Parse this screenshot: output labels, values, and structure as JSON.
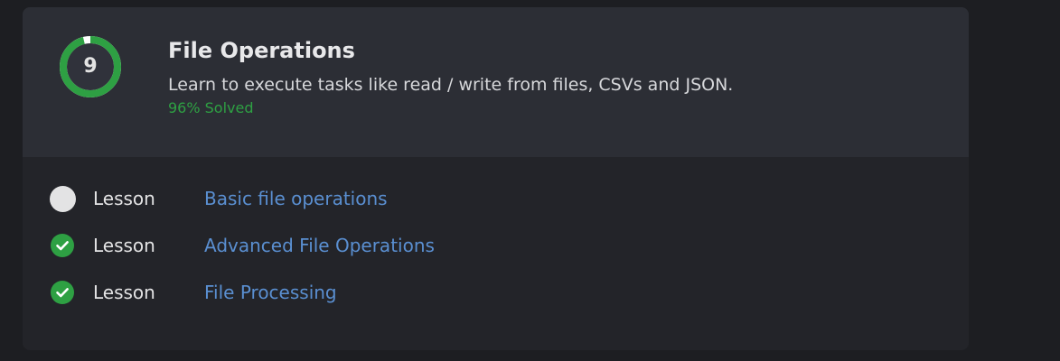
{
  "chapter": {
    "number": "9",
    "title": "File Operations",
    "description": "Learn to execute tasks like read / write from files, CSVs and JSON.",
    "solved_text": "96% Solved",
    "solved_fraction": 0.96
  },
  "lessons": [
    {
      "type": "Lesson",
      "title": "Basic file operations",
      "status": "not-completed"
    },
    {
      "type": "Lesson",
      "title": "Advanced File Operations",
      "status": "completed"
    },
    {
      "type": "Lesson",
      "title": "File Processing",
      "status": "completed"
    }
  ],
  "colors": {
    "progress": "#2ea043",
    "progress_track": "#ffffff",
    "link": "#5a8fd1",
    "pending_dot": "#e3e3e4"
  },
  "icons": {
    "completed": "checkmark-circle-icon",
    "pending": "empty-circle-icon"
  }
}
